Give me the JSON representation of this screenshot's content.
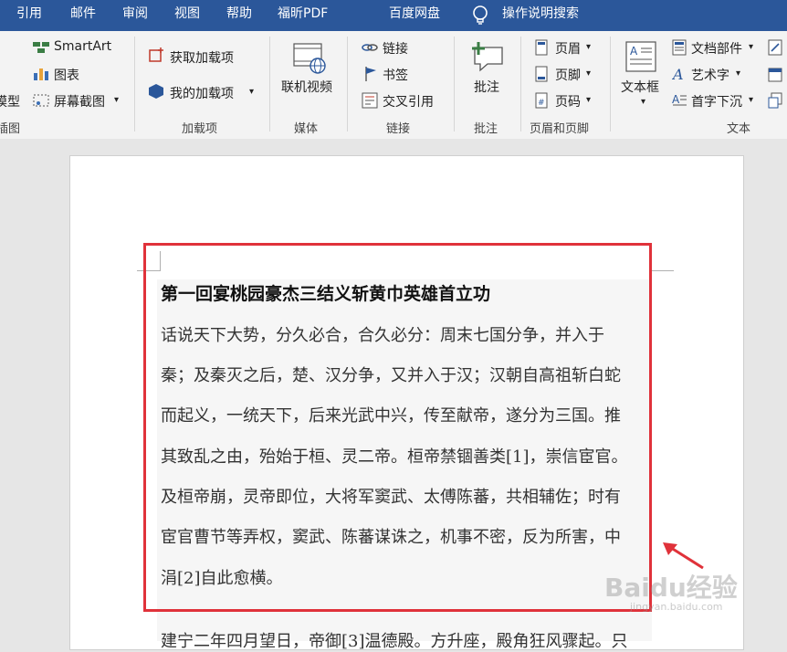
{
  "tabs": [
    "引用",
    "邮件",
    "审阅",
    "视图",
    "帮助",
    "福昕PDF",
    "百度网盘"
  ],
  "tell_me": "操作说明搜索",
  "ribbon": {
    "illustrations": {
      "smartart": "SmartArt",
      "chart": "图表",
      "screenshot": "屏幕截图",
      "model": "模型",
      "label": "插图"
    },
    "addins": {
      "get": "获取加载项",
      "my": "我的加载项",
      "label": "加载项"
    },
    "media": {
      "online_video": "联机视频",
      "label": "媒体"
    },
    "links": {
      "link": "链接",
      "bookmark": "书签",
      "cross_ref": "交叉引用",
      "label": "链接"
    },
    "comments": {
      "comment": "批注",
      "label": "批注"
    },
    "header_footer": {
      "header": "页眉",
      "footer": "页脚",
      "page_number": "页码",
      "label": "页眉和页脚"
    },
    "text": {
      "textbox": "文本框",
      "quick_parts": "文档部件",
      "wordart": "艺术字",
      "dropcap": "首字下沉",
      "label": "文本"
    }
  },
  "document": {
    "heading": "第一回宴桃园豪杰三结义斩黄巾英雄首立功",
    "lines": [
      "话说天下大势，分久必合，合久必分：周末七国分争，并入于",
      "秦；及秦灭之后，楚、汉分争，又并入于汉；汉朝自高祖斩白蛇",
      "而起义，一统天下，后来光武中兴，传至献帝，遂分为三国。推",
      "其致乱之由，殆始于桓、灵二帝。桓帝禁锢善类[1]，崇信宦官。",
      "及桓帝崩，灵帝即位，大将军窦武、太傅陈蕃，共相辅佐；时有",
      "宦官曹节等弄权，窦武、陈蕃谋诛之，机事不密，反为所害，中",
      "涓[2]自此愈横。"
    ],
    "next_line": "建宁二年四月望日，帝御[3]温德殿。方升座，殿角狂风骤起。只"
  },
  "watermark": "Baidu经验",
  "watermark_sub": "jingyan.baidu.com"
}
